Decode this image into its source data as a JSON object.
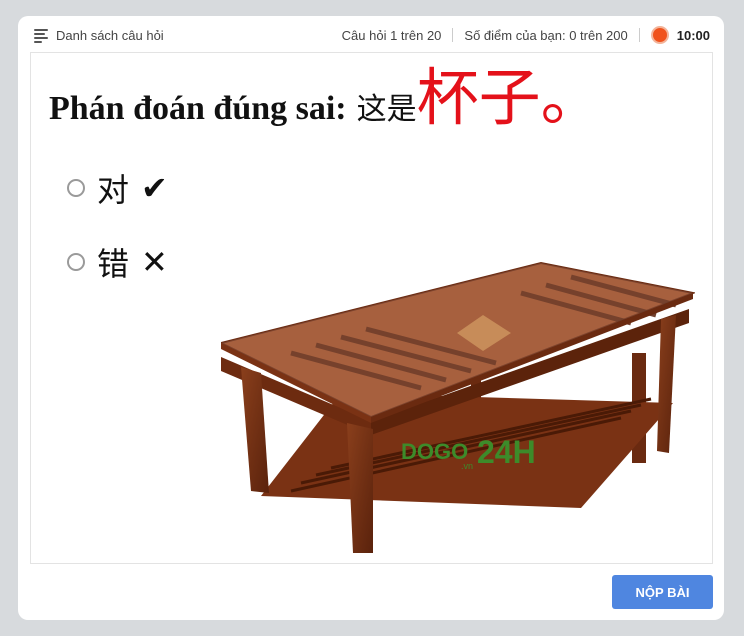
{
  "topbar": {
    "question_list_label": "Danh sách câu hỏi",
    "question_progress": "Câu hỏi 1 trên 20",
    "score_text": "Số điểm của bạn: 0 trên 200",
    "timer": "10:00",
    "timer_color": "#f0521c"
  },
  "question": {
    "prefix": "Phán đoán đúng sai:",
    "sentence_start": "这是",
    "highlight": "杯子。",
    "highlight_color": "#e4111a"
  },
  "options": [
    {
      "text": "对",
      "mark": "✔"
    },
    {
      "text": "错",
      "mark": "✕"
    }
  ],
  "image": {
    "subject": "wooden-coffee-table",
    "watermark": "DOGO.vn 24H"
  },
  "submit_label": "NỘP BÀI"
}
